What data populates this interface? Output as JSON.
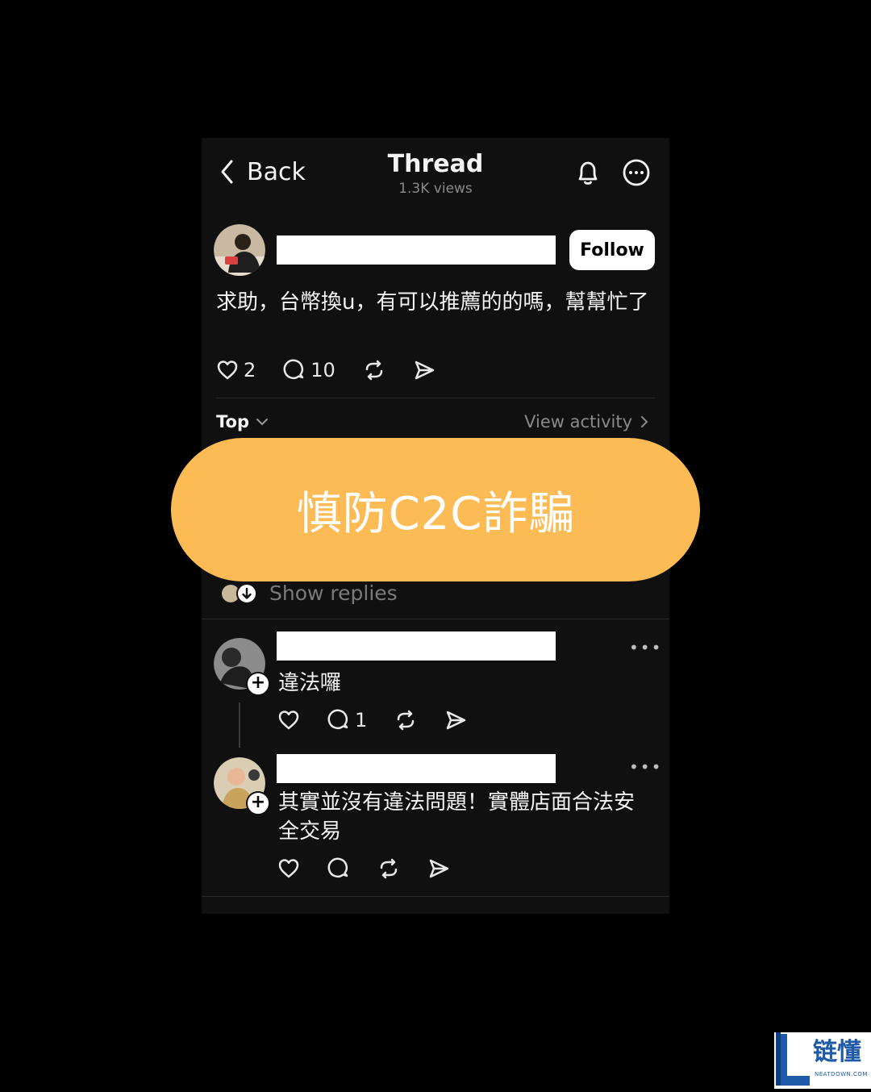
{
  "header": {
    "back_label": "Back",
    "title": "Thread",
    "views": "1.3K views"
  },
  "post": {
    "follow_label": "Follow",
    "text": "求助，台幣換u，有可以推薦的的嗎，幫幫忙了",
    "likes": "2",
    "comments": "10"
  },
  "replies_bar": {
    "sort_label": "Top",
    "activity_label": "View activity"
  },
  "show_replies_label": "Show replies",
  "replies": [
    {
      "text": "違法囉",
      "comments": "1"
    },
    {
      "text": "其實並沒有違法問題！實體店面合法安全交易"
    }
  ],
  "banner": {
    "text": "慎防C2C詐騙",
    "color": "#fdbb56"
  },
  "watermark": {
    "cn": "链懂",
    "en": "NEATDOWN.COM"
  },
  "colors": {
    "background": "#000000",
    "panel": "#101010",
    "muted": "#8a8a8a"
  }
}
